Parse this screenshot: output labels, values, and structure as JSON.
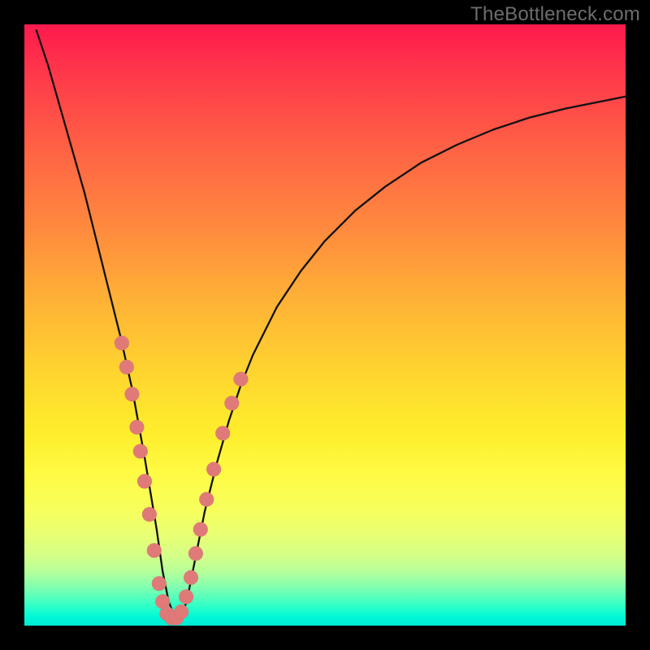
{
  "watermark": "TheBottleneck.com",
  "colors": {
    "dot": "#e07a78",
    "curve": "#111111",
    "frame": "#000000"
  },
  "chart_data": {
    "type": "line",
    "title": "",
    "xlabel": "",
    "ylabel": "",
    "xlim": [
      0,
      100
    ],
    "ylim": [
      0,
      100
    ],
    "grid": false,
    "legend": false,
    "series": [
      {
        "name": "bottleneck-curve",
        "x": [
          2,
          4,
          6,
          8,
          10,
          12,
          14,
          16,
          18,
          20,
          21,
          22,
          23,
          24,
          25,
          26,
          27,
          28,
          30,
          32,
          34,
          36,
          38,
          42,
          46,
          50,
          55,
          60,
          66,
          72,
          78,
          84,
          90,
          96,
          100
        ],
        "y": [
          99,
          93,
          86,
          79,
          72,
          64,
          56,
          48,
          39,
          28,
          22,
          16,
          9,
          4,
          1.5,
          1.5,
          4,
          9,
          19,
          27,
          34,
          40,
          45,
          53,
          59,
          64,
          69,
          73,
          77,
          80,
          82.5,
          84.5,
          86,
          87.2,
          88
        ]
      }
    ],
    "markers": {
      "name": "highlight-dots",
      "x": [
        16.2,
        17.0,
        17.9,
        18.7,
        19.3,
        20.0,
        20.8,
        21.6,
        22.4,
        23.0,
        23.7,
        24.5,
        25.3,
        26.1,
        26.9,
        27.7,
        28.5,
        29.3,
        30.3,
        31.5,
        33.0,
        34.5,
        36.0
      ],
      "y": [
        47.0,
        43.0,
        38.5,
        33.0,
        29.0,
        24.0,
        18.5,
        12.5,
        7.0,
        4.0,
        2.0,
        1.3,
        1.3,
        2.3,
        4.8,
        8.0,
        12.0,
        16.0,
        21.0,
        26.0,
        32.0,
        37.0,
        41.0
      ]
    }
  }
}
